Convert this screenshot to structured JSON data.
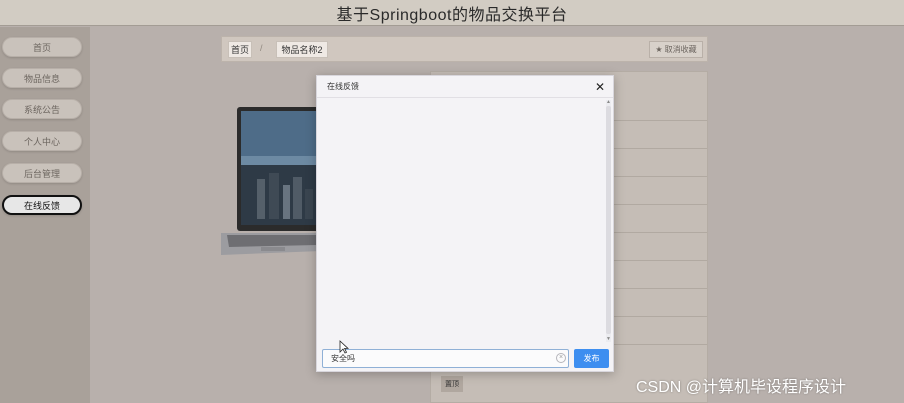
{
  "header": {
    "title": "基于Springboot的物品交换平台"
  },
  "sidebar": {
    "items": [
      {
        "label": "首页"
      },
      {
        "label": "物品信息"
      },
      {
        "label": "系统公告"
      },
      {
        "label": "个人中心"
      },
      {
        "label": "后台管理"
      },
      {
        "label": "在线反馈",
        "active": true
      }
    ]
  },
  "breadcrumb": {
    "home": "首页",
    "separator": "/",
    "current": "物品名称2"
  },
  "favorite": {
    "label": "取消收藏",
    "icon": "star-icon"
  },
  "detail": {
    "button_label": "置顶"
  },
  "modal": {
    "title": "在线反馈",
    "close_icon": "close-icon",
    "input_value": "安全吗",
    "send_label": "发布"
  },
  "watermark": "CSDN @计算机毕设程序设计",
  "colors": {
    "accent": "#3d8ef0",
    "sidebar": "#a9a19a",
    "overlay": "#b8b0ac"
  }
}
